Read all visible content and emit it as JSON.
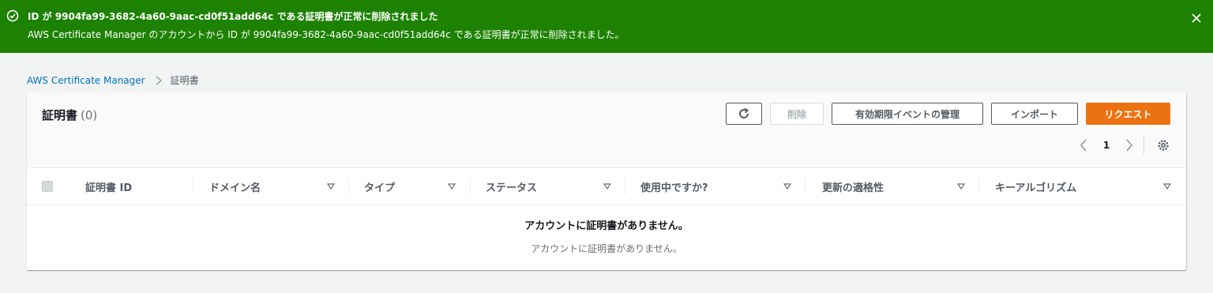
{
  "flash": {
    "title": "ID が 9904fa99-3682-4a60-9aac-cd0f51add64c である証明書が正常に削除されました",
    "message": "AWS Certificate Manager のアカウントから ID が 9904fa99-3682-4a60-9aac-cd0f51add64c である証明書が正常に削除されました。",
    "icon": "success-check-icon",
    "close_icon": "close-icon",
    "color": "#1d8102"
  },
  "breadcrumb": {
    "service": "AWS Certificate Manager",
    "current": "証明書"
  },
  "panel": {
    "title": "証明書",
    "count": "(0)"
  },
  "toolbar": {
    "refresh_icon": "refresh-icon",
    "delete_label": "削除",
    "manage_label": "有効期限イベントの管理",
    "import_label": "インポート",
    "request_label": "リクエスト",
    "accent_color": "#ec7211"
  },
  "pagination": {
    "page": "1"
  },
  "table": {
    "columns": [
      "証明書 ID",
      "ドメイン名",
      "タイプ",
      "ステータス",
      "使用中ですか?",
      "更新の適格性",
      "キーアルゴリズム"
    ],
    "empty_title": "アカウントに証明書がありません。",
    "empty_description": "アカウントに証明書がありません。"
  }
}
